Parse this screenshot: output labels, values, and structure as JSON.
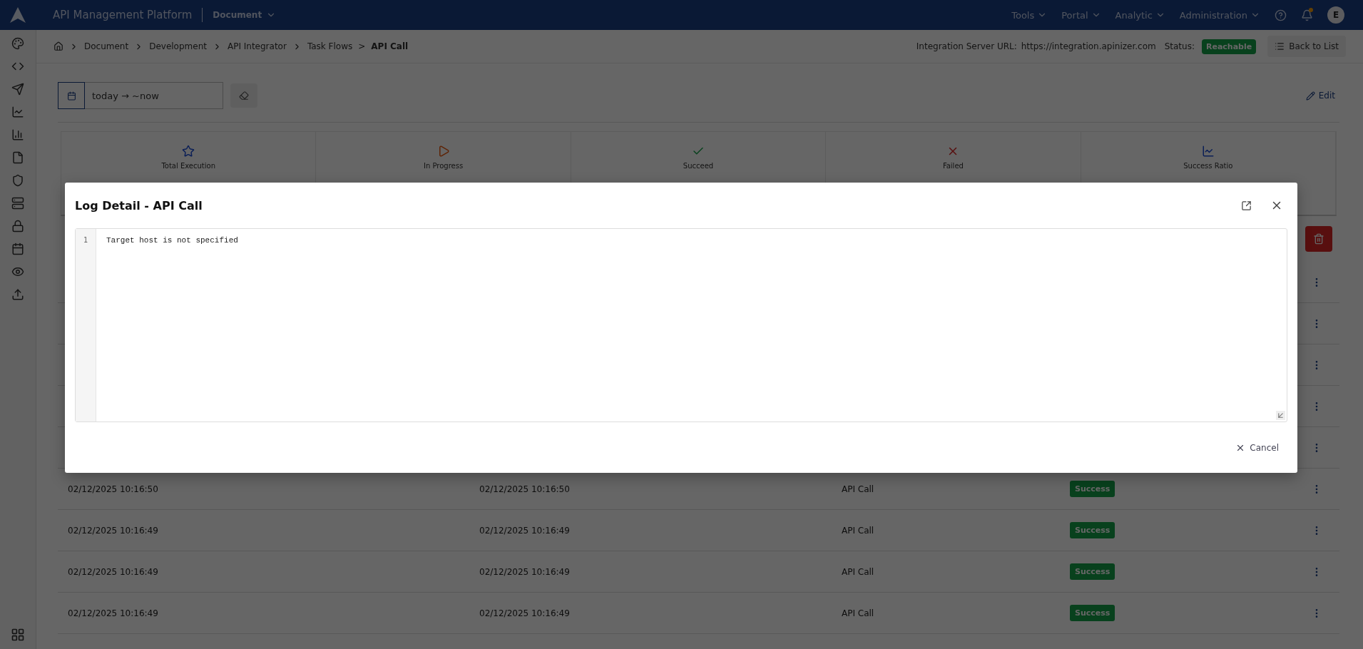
{
  "topbar": {
    "title": "API Management Platform",
    "workspace": "Document",
    "menus": [
      "Tools",
      "Portal",
      "Analytic",
      "Administration"
    ],
    "avatar": "E"
  },
  "breadcrumb": {
    "crumbs": [
      "Document",
      "Development",
      "API Integrator"
    ],
    "parent": "Task Flows",
    "separator": ">",
    "current": "API Call"
  },
  "server": {
    "label": "Integration Server URL:",
    "url": "https://integration.apinizer.com",
    "status_label": "Status:",
    "status": "Reachable"
  },
  "back_button": "Back to List",
  "date_filter": {
    "value": "today → ~now"
  },
  "edit_button": "Edit",
  "stats": [
    {
      "kind": "total",
      "label": "Total Execution"
    },
    {
      "kind": "progress",
      "label": "In Progress"
    },
    {
      "kind": "succeed",
      "label": "Succeed"
    },
    {
      "kind": "failed",
      "label": "Failed"
    },
    {
      "kind": "ratio",
      "label": "Success Ratio"
    }
  ],
  "modal": {
    "title": "Log Detail - API Call",
    "lines": [
      {
        "number": "1",
        "text": "Target host is not specified"
      }
    ],
    "cancel": "Cancel"
  },
  "table": {
    "rows": [
      {
        "column_1": "02/12/2025 10:16:50",
        "column_2": "02/12/2025 10:16:50",
        "column_3": "API Call",
        "status": "Success"
      },
      {
        "column_1": "02/12/2025 10:16:49",
        "column_2": "02/12/2025 10:16:49",
        "column_3": "API Call",
        "status": "Success"
      },
      {
        "column_1": "02/12/2025 10:16:49",
        "column_2": "02/12/2025 10:16:49",
        "column_3": "API Call",
        "status": "Success"
      },
      {
        "column_1": "02/12/2025 10:16:49",
        "column_2": "02/12/2025 10:16:49",
        "column_3": "API Call",
        "status": "Success"
      }
    ]
  }
}
